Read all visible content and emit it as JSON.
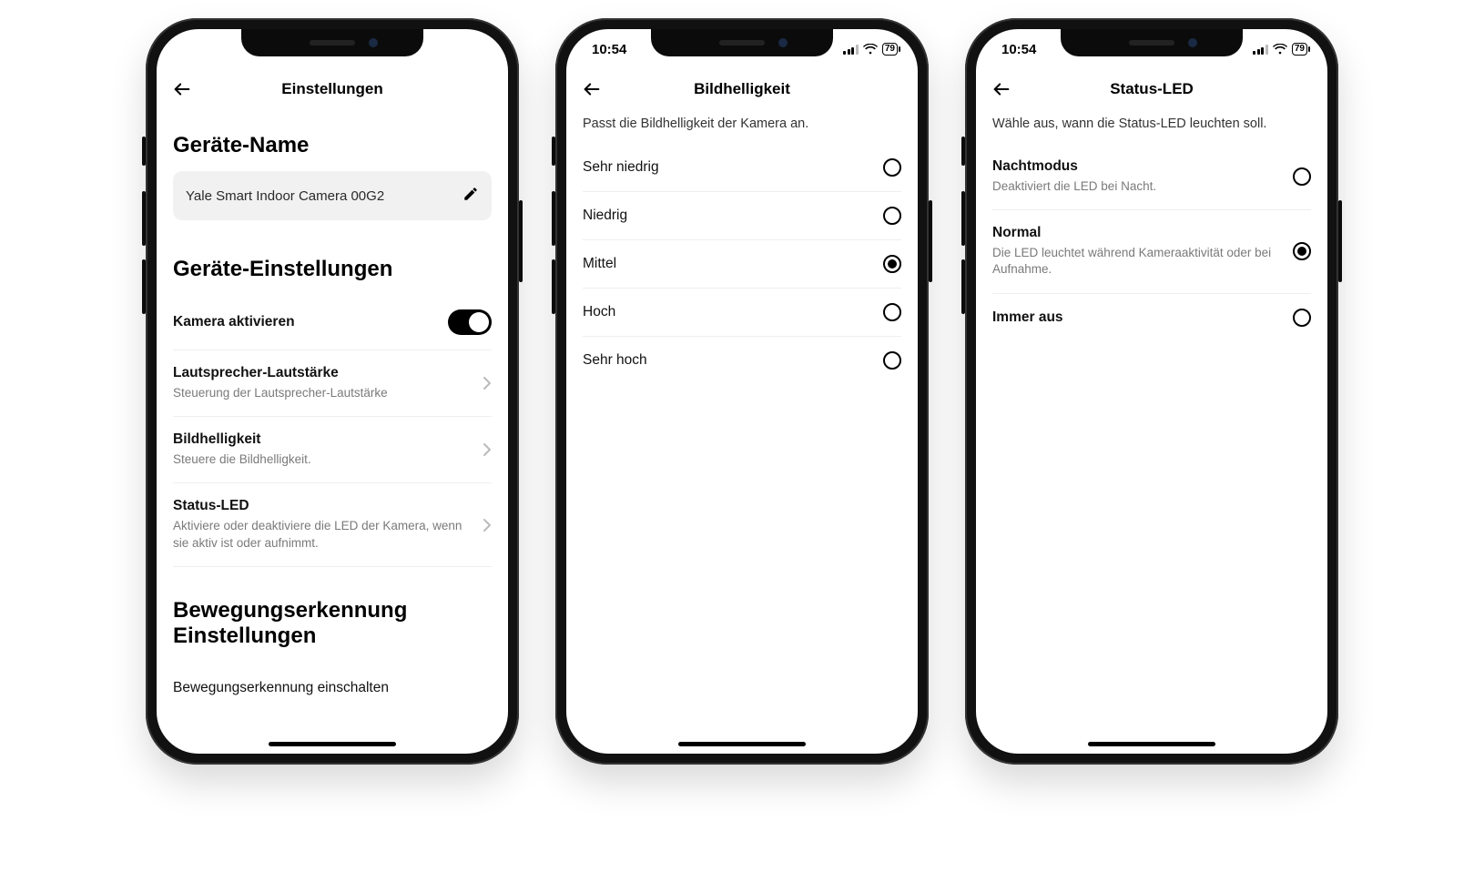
{
  "status": {
    "time": "10:54",
    "battery": "79"
  },
  "phone1": {
    "nav_title": "Einstellungen",
    "section_device_name": "Geräte-Name",
    "device_name_value": "Yale Smart Indoor Camera 00G2",
    "section_device_settings": "Geräte-Einstellungen",
    "rows": {
      "activate": {
        "label": "Kamera aktivieren"
      },
      "speaker": {
        "label": "Lautsprecher-Lautstärke",
        "sub": "Steuerung der Lautsprecher-Lautstärke"
      },
      "brightness": {
        "label": "Bildhelligkeit",
        "sub": "Steuere die Bildhelligkeit."
      },
      "statusled": {
        "label": "Status-LED",
        "sub": "Aktiviere oder deaktiviere die LED der Kamera, wenn sie aktiv ist oder aufnimmt."
      }
    },
    "section_motion": "Bewegungserkennung Einstellungen",
    "motion_toggle_label": "Bewegungserkennung einschalten"
  },
  "phone2": {
    "nav_title": "Bildhelligkeit",
    "desc": "Passt die Bildhelligkeit der Kamera an.",
    "options": [
      {
        "label": "Sehr niedrig",
        "selected": false
      },
      {
        "label": "Niedrig",
        "selected": false
      },
      {
        "label": "Mittel",
        "selected": true
      },
      {
        "label": "Hoch",
        "selected": false
      },
      {
        "label": "Sehr hoch",
        "selected": false
      }
    ]
  },
  "phone3": {
    "nav_title": "Status-LED",
    "desc": "Wähle aus, wann die Status-LED leuchten soll.",
    "options": [
      {
        "label": "Nachtmodus",
        "sub": "Deaktiviert die LED bei Nacht.",
        "selected": false
      },
      {
        "label": "Normal",
        "sub": "Die LED leuchtet während Kameraaktivität oder bei Aufnahme.",
        "selected": true
      },
      {
        "label": "Immer aus",
        "selected": false
      }
    ]
  }
}
